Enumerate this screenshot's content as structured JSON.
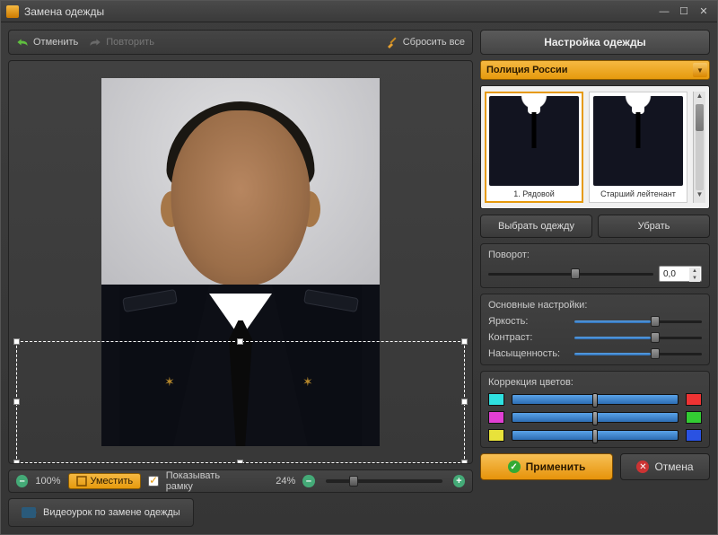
{
  "window": {
    "title": "Замена одежды"
  },
  "toolbar": {
    "undo": "Отменить",
    "redo": "Повторить",
    "reset_all": "Сбросить все"
  },
  "zoom": {
    "left_pct": "100%",
    "fit": "Уместить",
    "show_frame": "Показывать рамку",
    "right_pct": "24%"
  },
  "video_lesson": "Видеоурок по замене одежды",
  "panel": {
    "title": "Настройка одежды",
    "category": "Полиция России",
    "thumbs": [
      {
        "caption": "1. Рядовой"
      },
      {
        "caption": "Старший лейтенант"
      }
    ],
    "choose": "Выбрать одежду",
    "remove": "Убрать",
    "rotation_label": "Поворот:",
    "rotation_value": "0,0",
    "basic_label": "Основные настройки:",
    "brightness": "Яркость:",
    "contrast": "Контраст:",
    "saturation": "Насыщенность:",
    "color_corr": "Коррекция цветов:"
  },
  "footer": {
    "apply": "Применить",
    "cancel": "Отмена"
  }
}
